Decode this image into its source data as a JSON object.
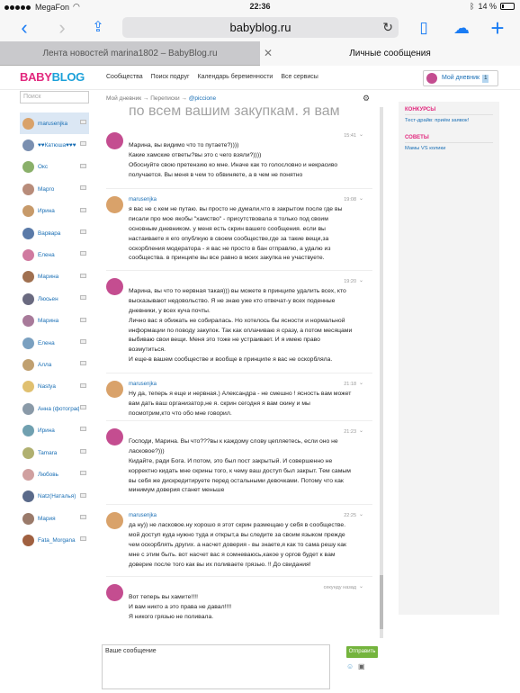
{
  "status_bar": {
    "carrier": "MegaFon",
    "time": "22:36",
    "battery": "14 %"
  },
  "browser": {
    "url": "babyblog.ru"
  },
  "tabs": [
    {
      "label": "Лента новостей marina1802 – BabyBlog.ru"
    },
    {
      "label": "Личные сообщения"
    }
  ],
  "site": {
    "logo_part1": "BABY",
    "logo_part2": "BLOG",
    "nav": [
      "Сообщества",
      "Поиск подруг",
      "Календарь беременности",
      "Все сервисы"
    ],
    "my_diary": "Мой дневник",
    "my_diary_count": "1",
    "search_placeholder": "Поиск"
  },
  "breadcrumb": {
    "item1": "Мой дневник",
    "sep1": "→",
    "item2": "Переписки",
    "sep2": "→",
    "item3": "@piccione"
  },
  "contacts": [
    {
      "name": "marusenjka",
      "color": "#d9a26a"
    },
    {
      "name": "♥♥Катюша♥♥♥",
      "color": "#7a8fb0"
    },
    {
      "name": "Окс",
      "color": "#8ab06a"
    },
    {
      "name": "Марго",
      "color": "#b88c7a"
    },
    {
      "name": "Ирина",
      "color": "#c79a6a"
    },
    {
      "name": "Варвара",
      "color": "#5a7aa8"
    },
    {
      "name": "Елена",
      "color": "#d07aa0"
    },
    {
      "name": "Марина",
      "color": "#a07050"
    },
    {
      "name": "Люсьен",
      "color": "#6a6a80"
    },
    {
      "name": "Марина",
      "color": "#a87a9a"
    },
    {
      "name": "Елена",
      "color": "#7aa0c0"
    },
    {
      "name": "Алла",
      "color": "#c0a070"
    },
    {
      "name": "Nastya",
      "color": "#e0c070"
    },
    {
      "name": "Анна (фотограф)",
      "color": "#8a9aa8"
    },
    {
      "name": "Ирина",
      "color": "#70a0b0"
    },
    {
      "name": "Tamara",
      "color": "#b0b070"
    },
    {
      "name": "Любовь",
      "color": "#d0a0a0"
    },
    {
      "name": "Natz(Наталья)",
      "color": "#5a6a8a"
    },
    {
      "name": "Мария",
      "color": "#9a7a6a"
    },
    {
      "name": "Fata_Morgana",
      "color": "#a06040"
    }
  ],
  "thread": {
    "top_fade": "по всем вашим закупкам. я вам больше отвечать не буду. спасибо и надеюсь\nна понимание.",
    "messages": [
      {
        "author": "",
        "time": "15:41",
        "avatar_color": "#c44d90",
        "text": "Марина, вы видимо что то путаете?))))\nКакие хамские ответы?вы это с чего взяли?))))\nОбоснуйте свою претензию ко мне. Иначе как то голословно и некрасиво\nполучается. Вы меня в чем то обвиняете, а в чем не понятно"
      },
      {
        "author": "marusenjka",
        "time": "19:08",
        "avatar_color": "#d9a26a",
        "text": "я вас не с кем не путаю. вы просто не думали,что в закрытом после где вы\nписали про мое якобы \"хамство\" - присутствовала я только под своим\nосновным дневником. у меня есть скрин вашего сообщения. если вы\nнастаиваете я его опублкую в своем сообществе,где за такие вещи,за\nоскорбления модератора -  я вас не просто в бан отправлю, а удалю из\nсообщества. в принципе вы все равно в моих закупка не участвуете."
      },
      {
        "author": "",
        "time": "19:20",
        "avatar_color": "#c44d90",
        "text": "Марина, вы что то нервная такая))) вы можете в принципе удалить всех, кто\nвысказывают недовольство. Я не знаю уже кто отвечат-у всех поденные\nдневники, у всех куча почты.\nЛично вас я обижать не собиралась. Но хотелось бы ясности и нормальной\nинформации по поводу закупок. Так как оплачиваю я сразу, а потом месяцами\nвыбиваю свои вещи. Меня это тоже не устраивает. И я имею право\nвозмутиться.\nИ еще-в вашем сообществе и вообще в принципе я вас не оскорбляла."
      },
      {
        "author": "marusenjka",
        "time": "21:18",
        "avatar_color": "#d9a26a",
        "text": "Ну да, теперь я еще и нервная.) Александра - не смешно ! ясность вам может\nвам дать ваш организатор,не я. скрин сегодня я вам скину и мы\nпосмотрим,кто что обо мне говорил."
      },
      {
        "author": "",
        "time": "21:23",
        "avatar_color": "#c44d90",
        "text": "Господи, Марина. Вы что???вы к каждому слову цепляетесь, если оно не\nласковое?)))\nКидайте, ради Бога. И потом, это был пост закрытый. И совершенно не\nкорректно кидать мне скрины того, к чему ваш доступ был закрыт. Тем самым\nвы себя же дискредитируете перед остальными девочками. Потому что как\nминимум доверия станет меньше"
      },
      {
        "author": "marusenjka",
        "time": "22:25",
        "avatar_color": "#d9a26a",
        "text": "да ну)) не ласковое.ну хорошо я этот скрин размещаю у себя в сообществе.\nмой доступ куда нужно туда и открыт,а вы следите за своим языком прежде\nчем оскорблять других. а насчет доверия - вы знаете,я как то сама решу как\nмне с этим быть. вот насчет вас я сомневаюсь,какое у оргов будет к вам\nдоверие после того как вы их поливаете грязью. !! До свидания!"
      },
      {
        "author": "",
        "time": "секунду назад",
        "avatar_color": "#c44d90",
        "text": "Вот теперь вы хамите!!!!\nИ вам никто а это права не давал!!!!\nЯ никого грязью не поливала."
      }
    ]
  },
  "compose": {
    "placeholder": "Ваше сообщение",
    "send_label": "Отправить"
  },
  "sidebar": {
    "contests_title": "КОНКУРСЫ",
    "contests_link": "Тест-драйв: приём заявок!",
    "tips_title": "СОВЕТЫ",
    "tips_link": "Мамы VS колики"
  }
}
